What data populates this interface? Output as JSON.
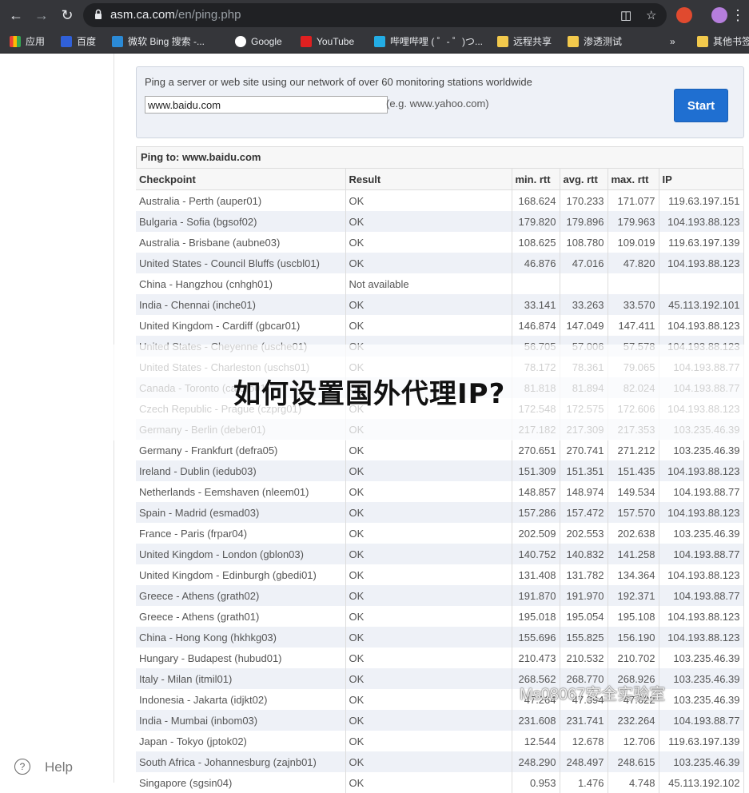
{
  "browser": {
    "url_host": "asm.ca.com",
    "url_path": "/en/ping.php",
    "bookmarks": [
      "应用",
      "百度",
      "微软 Bing 搜索 -...",
      "Google",
      "YouTube",
      "哔哩哔哩 ( ゜- ゜)つ...",
      "远程共享",
      "渗透测试",
      "»",
      "其他书签"
    ]
  },
  "ping": {
    "description": "Ping a server or web site using our network of over 60 monitoring stations worldwide",
    "input_value": "www.baidu.com",
    "example": "(e.g. www.yahoo.com)",
    "start_label": "Start"
  },
  "results": {
    "title": "Ping to: www.baidu.com",
    "headers": [
      "Checkpoint",
      "Result",
      "min. rtt",
      "avg. rtt",
      "max. rtt",
      "IP"
    ],
    "rows": [
      [
        "Australia - Perth (auper01)",
        "OK",
        "168.624",
        "170.233",
        "171.077",
        "119.63.197.151"
      ],
      [
        "Bulgaria - Sofia (bgsof02)",
        "OK",
        "179.820",
        "179.896",
        "179.963",
        "104.193.88.123"
      ],
      [
        "Australia - Brisbane (aubne03)",
        "OK",
        "108.625",
        "108.780",
        "109.019",
        "119.63.197.139"
      ],
      [
        "United States - Council Bluffs (uscbl01)",
        "OK",
        "46.876",
        "47.016",
        "47.820",
        "104.193.88.123"
      ],
      [
        "China - Hangzhou (cnhgh01)",
        "Not available",
        "",
        "",
        "",
        ""
      ],
      [
        "India - Chennai (inche01)",
        "OK",
        "33.141",
        "33.263",
        "33.570",
        "45.113.192.101"
      ],
      [
        "United Kingdom - Cardiff (gbcar01)",
        "OK",
        "146.874",
        "147.049",
        "147.411",
        "104.193.88.123"
      ],
      [
        "United States - Cheyenne (usche01)",
        "OK",
        "56.705",
        "57.006",
        "57.578",
        "104.193.88.123"
      ],
      [
        "United States - Charleston (uschs01)",
        "OK",
        "78.172",
        "78.361",
        "79.065",
        "104.193.88.77"
      ],
      [
        "Canada - Toronto (catoro01)",
        "OK",
        "81.818",
        "81.894",
        "82.024",
        "104.193.88.77"
      ],
      [
        "Czech Republic - Prague (czprg01)",
        "OK",
        "172.548",
        "172.575",
        "172.606",
        "104.193.88.123"
      ],
      [
        "Germany - Berlin (deber01)",
        "OK",
        "217.182",
        "217.309",
        "217.353",
        "103.235.46.39"
      ],
      [
        "Germany - Frankfurt (defra05)",
        "OK",
        "270.651",
        "270.741",
        "271.212",
        "103.235.46.39"
      ],
      [
        "Ireland - Dublin (iedub03)",
        "OK",
        "151.309",
        "151.351",
        "151.435",
        "104.193.88.123"
      ],
      [
        "Netherlands - Eemshaven (nleem01)",
        "OK",
        "148.857",
        "148.974",
        "149.534",
        "104.193.88.77"
      ],
      [
        "Spain - Madrid (esmad03)",
        "OK",
        "157.286",
        "157.472",
        "157.570",
        "104.193.88.123"
      ],
      [
        "France - Paris (frpar04)",
        "OK",
        "202.509",
        "202.553",
        "202.638",
        "103.235.46.39"
      ],
      [
        "United Kingdom - London (gblon03)",
        "OK",
        "140.752",
        "140.832",
        "141.258",
        "104.193.88.77"
      ],
      [
        "United Kingdom - Edinburgh (gbedi01)",
        "OK",
        "131.408",
        "131.782",
        "134.364",
        "104.193.88.123"
      ],
      [
        "Greece - Athens (grath02)",
        "OK",
        "191.870",
        "191.970",
        "192.371",
        "104.193.88.77"
      ],
      [
        "Greece - Athens (grath01)",
        "OK",
        "195.018",
        "195.054",
        "195.108",
        "104.193.88.123"
      ],
      [
        "China - Hong Kong (hkhkg03)",
        "OK",
        "155.696",
        "155.825",
        "156.190",
        "104.193.88.123"
      ],
      [
        "Hungary - Budapest (hubud01)",
        "OK",
        "210.473",
        "210.532",
        "210.702",
        "103.235.46.39"
      ],
      [
        "Italy - Milan (itmil01)",
        "OK",
        "268.562",
        "268.770",
        "268.926",
        "103.235.46.39"
      ],
      [
        "Indonesia - Jakarta (idjkt02)",
        "OK",
        "47.264",
        "47.394",
        "47.622",
        "103.235.46.39"
      ],
      [
        "India - Mumbai (inbom03)",
        "OK",
        "231.608",
        "231.741",
        "232.264",
        "104.193.88.77"
      ],
      [
        "Japan - Tokyo (jptok02)",
        "OK",
        "12.544",
        "12.678",
        "12.706",
        "119.63.197.139"
      ],
      [
        "South Africa - Johannesburg (zajnb01)",
        "OK",
        "248.290",
        "248.497",
        "248.615",
        "103.235.46.39"
      ],
      [
        "Singapore (sgsin04)",
        "OK",
        "0.953",
        "1.476",
        "4.748",
        "45.113.192.102"
      ]
    ]
  },
  "overlay": {
    "headline": "如何设置国外代理IP?",
    "wechat_mark": "Ms08067安全实验室"
  },
  "help": {
    "label": "Help",
    "icon": "?"
  }
}
